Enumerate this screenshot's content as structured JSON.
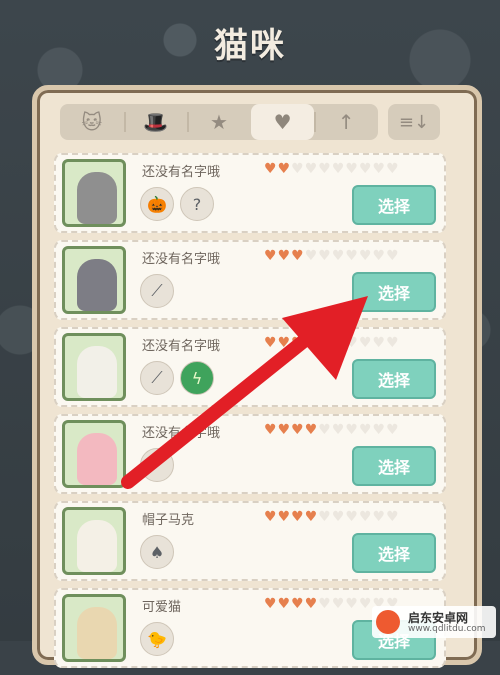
{
  "title": "猫咪",
  "tabs": [
    {
      "icon": "cat-icon",
      "glyph": "🐱",
      "active": false
    },
    {
      "icon": "chef-hat-icon",
      "glyph": "🎩",
      "active": false
    },
    {
      "icon": "star-icon",
      "glyph": "★",
      "active": false
    },
    {
      "icon": "heart-icon",
      "glyph": "♥",
      "active": true
    },
    {
      "icon": "up-arrow-icon",
      "glyph": "↑",
      "active": false
    }
  ],
  "sort_icon": "≡↓",
  "cats": [
    {
      "name": "还没有名字哦",
      "hearts_on": 2,
      "hearts_total": 10,
      "items": [
        "pumpkin-icon",
        "scroll-icon"
      ],
      "select_label": "选择"
    },
    {
      "name": "还没有名字哦",
      "hearts_on": 3,
      "hearts_total": 10,
      "items": [
        "fish-bone-icon"
      ],
      "select_label": "选择"
    },
    {
      "name": "还没有名字哦",
      "hearts_on": 3,
      "hearts_total": 10,
      "items": [
        "fish-bone-icon",
        "lightning-icon"
      ],
      "select_label": "选择"
    },
    {
      "name": "还没有名字哦",
      "hearts_on": 4,
      "hearts_total": 10,
      "items": [
        "fish-bone-icon"
      ],
      "select_label": "选择"
    },
    {
      "name": "帽子马克",
      "hearts_on": 4,
      "hearts_total": 10,
      "items": [
        "mushroom-icon"
      ],
      "select_label": "选择"
    },
    {
      "name": "可爱猫",
      "hearts_on": 4,
      "hearts_total": 10,
      "items": [
        "bird-icon"
      ],
      "select_label": "选择"
    }
  ],
  "colors": {
    "accent": "#7fd1bd",
    "heart": "#e6804e",
    "arrow": "#e21f26"
  },
  "watermark": {
    "title": "启东安卓网",
    "url": "www.qdlitdu.com"
  }
}
